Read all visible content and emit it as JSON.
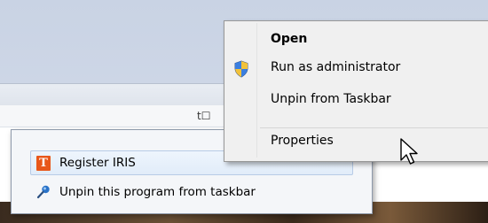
{
  "background": {
    "column_icon": "t☐"
  },
  "jump_list": {
    "items": [
      {
        "label": "Register IRIS",
        "icon": "t-app-icon",
        "icon_text": "T"
      },
      {
        "label": "Unpin this program from taskbar",
        "icon": "pin-icon"
      }
    ]
  },
  "context_menu": {
    "items": [
      {
        "label": "Open",
        "bold": true
      },
      {
        "label": "Run as administrator",
        "icon": "shield-icon"
      },
      {
        "label": "Unpin from Taskbar"
      },
      {
        "label": "Properties"
      }
    ]
  },
  "colors": {
    "app_icon": "#e8571a",
    "highlight_border": "#b7cbe6"
  }
}
